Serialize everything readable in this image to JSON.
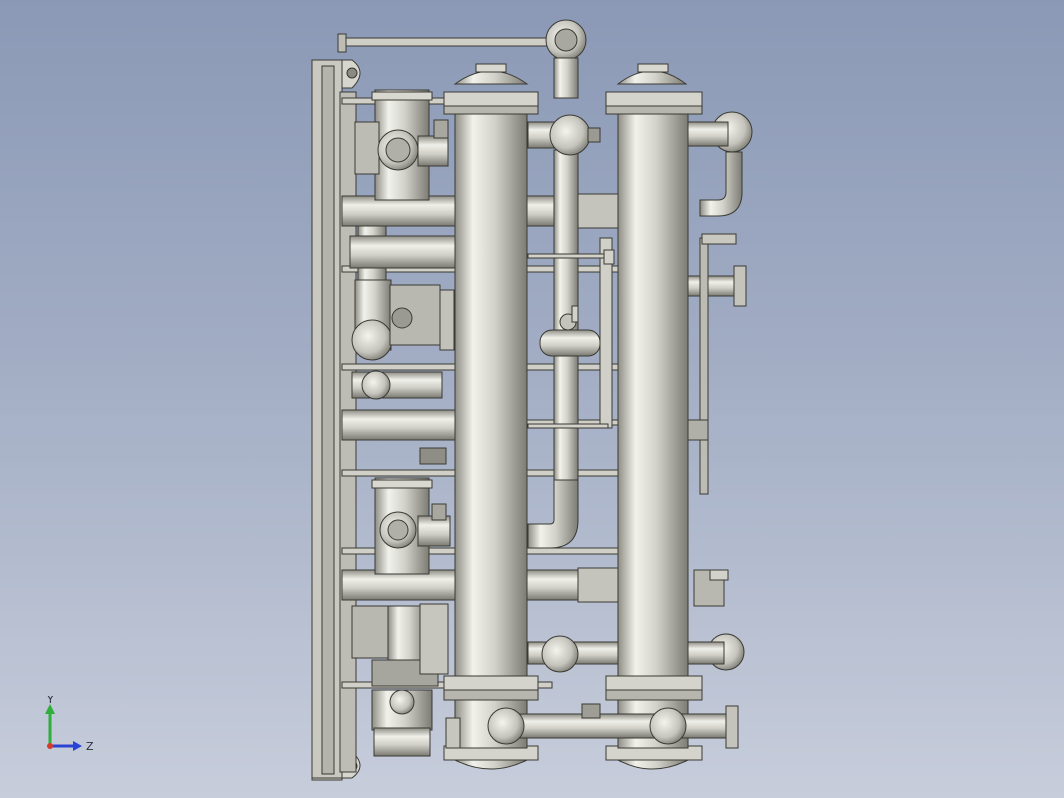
{
  "view": {
    "background_top": "#8b99b6",
    "background_bottom": "#c7cddb",
    "model_color": "#c9c9c1",
    "edge_color": "#3a3a34"
  },
  "triad": {
    "y_label": "Y",
    "z_label": "Z",
    "y_color": "#2fae3a",
    "z_color": "#2a44d6",
    "x_color": "#d63a2a"
  }
}
